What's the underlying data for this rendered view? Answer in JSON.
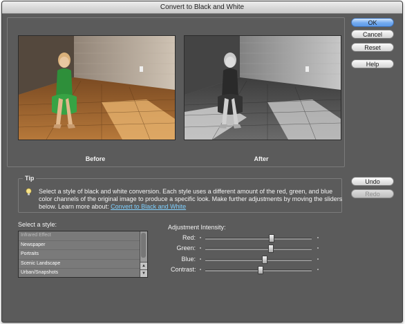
{
  "window": {
    "title": "Convert to Black and White"
  },
  "preview": {
    "before_label": "Before",
    "after_label": "After"
  },
  "buttons": {
    "ok": "OK",
    "cancel": "Cancel",
    "reset": "Reset",
    "help": "Help",
    "undo": "Undo",
    "redo": "Redo"
  },
  "tip": {
    "title": "Tip",
    "text": "Select a style of black and white conversion. Each style uses a different amount of the red, green, and blue color channels of the original image to produce a specific look. Make further adjustments by moving the sliders below. Learn more about: ",
    "link": "Convert to Black and White",
    "icon": "lightbulb-icon"
  },
  "styles": {
    "label": "Select a style:",
    "items": [
      "Infrared Effect",
      "Newspaper",
      "Portraits",
      "Scenic Landscape",
      "Urban/Snapshots"
    ]
  },
  "adjustment": {
    "label": "Adjustment Intensity:",
    "sliders": [
      {
        "label": "Red:",
        "value": 0.62
      },
      {
        "label": "Green:",
        "value": 0.61
      },
      {
        "label": "Blue:",
        "value": 0.55
      },
      {
        "label": "Contrast:",
        "value": 0.51
      }
    ]
  },
  "colors": {
    "dialog_bg": "#5b5b5b",
    "primary_button": "#73aaf0",
    "link": "#7fd0ff"
  }
}
